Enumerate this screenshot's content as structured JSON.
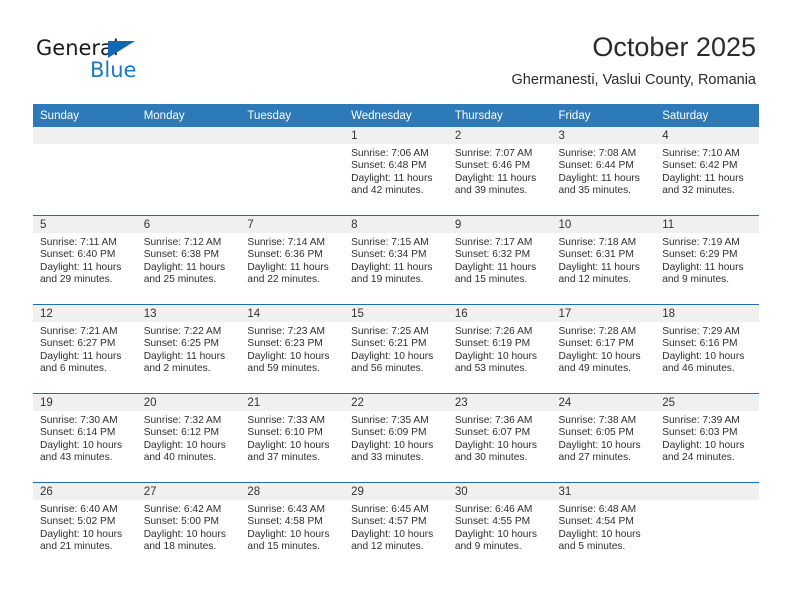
{
  "brand": {
    "name_part1": "General",
    "name_part2": "Blue",
    "accent_color": "#1b7ac4"
  },
  "header": {
    "title": "October 2025",
    "subtitle": "Ghermanesti, Vaslui County, Romania"
  },
  "theme": {
    "header_bg": "#2e7ab8",
    "row_rule": "#1f6eb0",
    "daynum_bg": "#f0f0f0"
  },
  "labels": {
    "sunrise_prefix": "Sunrise: ",
    "sunset_prefix": "Sunset: ",
    "daylight_prefix": "Daylight: "
  },
  "weekdays": [
    "Sunday",
    "Monday",
    "Tuesday",
    "Wednesday",
    "Thursday",
    "Friday",
    "Saturday"
  ],
  "weeks": [
    [
      {
        "day": "",
        "sunrise": "",
        "sunset": "",
        "daylight": ""
      },
      {
        "day": "",
        "sunrise": "",
        "sunset": "",
        "daylight": ""
      },
      {
        "day": "",
        "sunrise": "",
        "sunset": "",
        "daylight": ""
      },
      {
        "day": "1",
        "sunrise": "Sunrise: 7:06 AM",
        "sunset": "Sunset: 6:48 PM",
        "daylight": "Daylight: 11 hours and 42 minutes."
      },
      {
        "day": "2",
        "sunrise": "Sunrise: 7:07 AM",
        "sunset": "Sunset: 6:46 PM",
        "daylight": "Daylight: 11 hours and 39 minutes."
      },
      {
        "day": "3",
        "sunrise": "Sunrise: 7:08 AM",
        "sunset": "Sunset: 6:44 PM",
        "daylight": "Daylight: 11 hours and 35 minutes."
      },
      {
        "day": "4",
        "sunrise": "Sunrise: 7:10 AM",
        "sunset": "Sunset: 6:42 PM",
        "daylight": "Daylight: 11 hours and 32 minutes."
      }
    ],
    [
      {
        "day": "5",
        "sunrise": "Sunrise: 7:11 AM",
        "sunset": "Sunset: 6:40 PM",
        "daylight": "Daylight: 11 hours and 29 minutes."
      },
      {
        "day": "6",
        "sunrise": "Sunrise: 7:12 AM",
        "sunset": "Sunset: 6:38 PM",
        "daylight": "Daylight: 11 hours and 25 minutes."
      },
      {
        "day": "7",
        "sunrise": "Sunrise: 7:14 AM",
        "sunset": "Sunset: 6:36 PM",
        "daylight": "Daylight: 11 hours and 22 minutes."
      },
      {
        "day": "8",
        "sunrise": "Sunrise: 7:15 AM",
        "sunset": "Sunset: 6:34 PM",
        "daylight": "Daylight: 11 hours and 19 minutes."
      },
      {
        "day": "9",
        "sunrise": "Sunrise: 7:17 AM",
        "sunset": "Sunset: 6:32 PM",
        "daylight": "Daylight: 11 hours and 15 minutes."
      },
      {
        "day": "10",
        "sunrise": "Sunrise: 7:18 AM",
        "sunset": "Sunset: 6:31 PM",
        "daylight": "Daylight: 11 hours and 12 minutes."
      },
      {
        "day": "11",
        "sunrise": "Sunrise: 7:19 AM",
        "sunset": "Sunset: 6:29 PM",
        "daylight": "Daylight: 11 hours and 9 minutes."
      }
    ],
    [
      {
        "day": "12",
        "sunrise": "Sunrise: 7:21 AM",
        "sunset": "Sunset: 6:27 PM",
        "daylight": "Daylight: 11 hours and 6 minutes."
      },
      {
        "day": "13",
        "sunrise": "Sunrise: 7:22 AM",
        "sunset": "Sunset: 6:25 PM",
        "daylight": "Daylight: 11 hours and 2 minutes."
      },
      {
        "day": "14",
        "sunrise": "Sunrise: 7:23 AM",
        "sunset": "Sunset: 6:23 PM",
        "daylight": "Daylight: 10 hours and 59 minutes."
      },
      {
        "day": "15",
        "sunrise": "Sunrise: 7:25 AM",
        "sunset": "Sunset: 6:21 PM",
        "daylight": "Daylight: 10 hours and 56 minutes."
      },
      {
        "day": "16",
        "sunrise": "Sunrise: 7:26 AM",
        "sunset": "Sunset: 6:19 PM",
        "daylight": "Daylight: 10 hours and 53 minutes."
      },
      {
        "day": "17",
        "sunrise": "Sunrise: 7:28 AM",
        "sunset": "Sunset: 6:17 PM",
        "daylight": "Daylight: 10 hours and 49 minutes."
      },
      {
        "day": "18",
        "sunrise": "Sunrise: 7:29 AM",
        "sunset": "Sunset: 6:16 PM",
        "daylight": "Daylight: 10 hours and 46 minutes."
      }
    ],
    [
      {
        "day": "19",
        "sunrise": "Sunrise: 7:30 AM",
        "sunset": "Sunset: 6:14 PM",
        "daylight": "Daylight: 10 hours and 43 minutes."
      },
      {
        "day": "20",
        "sunrise": "Sunrise: 7:32 AM",
        "sunset": "Sunset: 6:12 PM",
        "daylight": "Daylight: 10 hours and 40 minutes."
      },
      {
        "day": "21",
        "sunrise": "Sunrise: 7:33 AM",
        "sunset": "Sunset: 6:10 PM",
        "daylight": "Daylight: 10 hours and 37 minutes."
      },
      {
        "day": "22",
        "sunrise": "Sunrise: 7:35 AM",
        "sunset": "Sunset: 6:09 PM",
        "daylight": "Daylight: 10 hours and 33 minutes."
      },
      {
        "day": "23",
        "sunrise": "Sunrise: 7:36 AM",
        "sunset": "Sunset: 6:07 PM",
        "daylight": "Daylight: 10 hours and 30 minutes."
      },
      {
        "day": "24",
        "sunrise": "Sunrise: 7:38 AM",
        "sunset": "Sunset: 6:05 PM",
        "daylight": "Daylight: 10 hours and 27 minutes."
      },
      {
        "day": "25",
        "sunrise": "Sunrise: 7:39 AM",
        "sunset": "Sunset: 6:03 PM",
        "daylight": "Daylight: 10 hours and 24 minutes."
      }
    ],
    [
      {
        "day": "26",
        "sunrise": "Sunrise: 6:40 AM",
        "sunset": "Sunset: 5:02 PM",
        "daylight": "Daylight: 10 hours and 21 minutes."
      },
      {
        "day": "27",
        "sunrise": "Sunrise: 6:42 AM",
        "sunset": "Sunset: 5:00 PM",
        "daylight": "Daylight: 10 hours and 18 minutes."
      },
      {
        "day": "28",
        "sunrise": "Sunrise: 6:43 AM",
        "sunset": "Sunset: 4:58 PM",
        "daylight": "Daylight: 10 hours and 15 minutes."
      },
      {
        "day": "29",
        "sunrise": "Sunrise: 6:45 AM",
        "sunset": "Sunset: 4:57 PM",
        "daylight": "Daylight: 10 hours and 12 minutes."
      },
      {
        "day": "30",
        "sunrise": "Sunrise: 6:46 AM",
        "sunset": "Sunset: 4:55 PM",
        "daylight": "Daylight: 10 hours and 9 minutes."
      },
      {
        "day": "31",
        "sunrise": "Sunrise: 6:48 AM",
        "sunset": "Sunset: 4:54 PM",
        "daylight": "Daylight: 10 hours and 5 minutes."
      },
      {
        "day": "",
        "sunrise": "",
        "sunset": "",
        "daylight": ""
      }
    ]
  ]
}
